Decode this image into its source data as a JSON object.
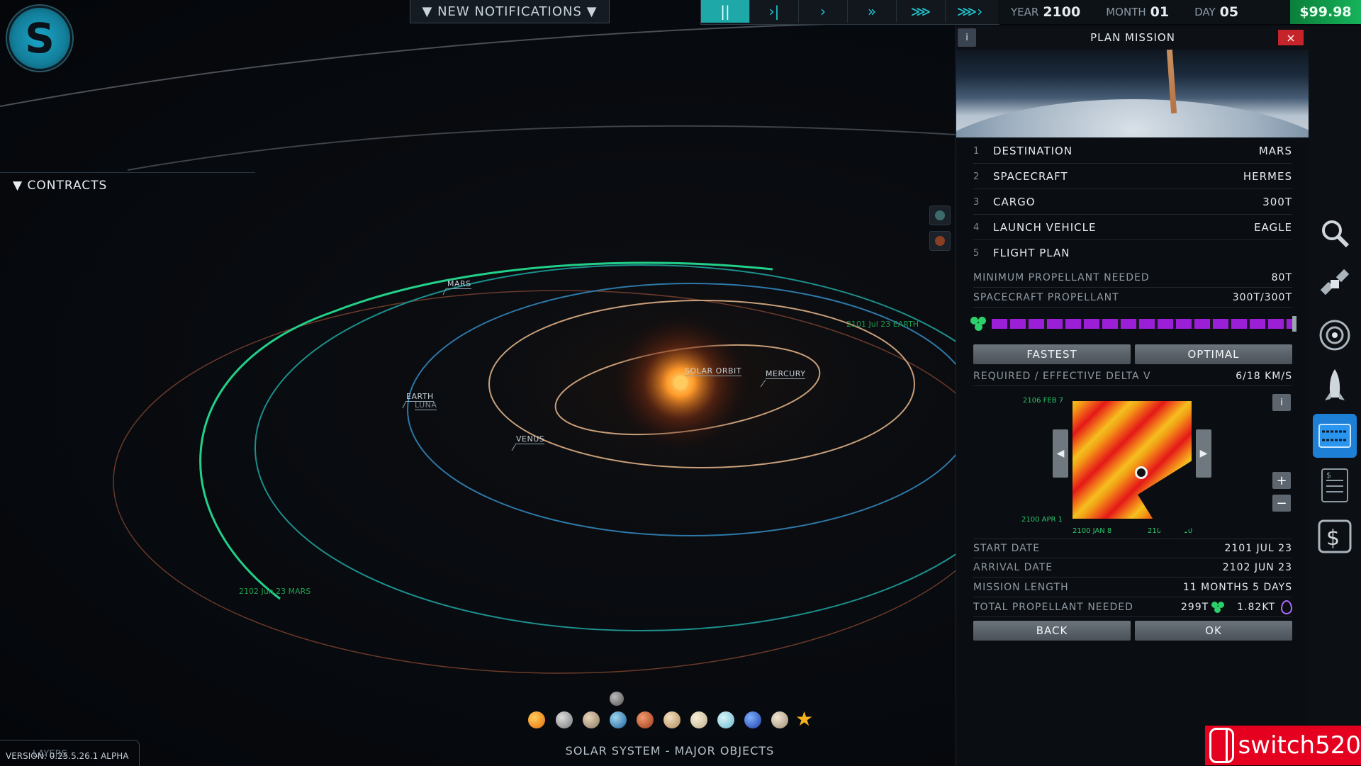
{
  "header": {
    "notifications_label": "▼ NEW NOTIFICATIONS ▼",
    "speed_controls": [
      "||",
      "›|",
      "›",
      "»",
      "⋙",
      "⋙›"
    ],
    "year_label": "YEAR",
    "year_value": "2100",
    "month_label": "MONTH",
    "month_value": "01",
    "day_label": "DAY",
    "day_value": "05",
    "money": "$99.98"
  },
  "logo_letter": "S",
  "contracts_label": "▼ CONTRACTS",
  "map": {
    "labels": {
      "mars": "MARS",
      "earth": "EARTH",
      "luna": "LUNA",
      "venus": "VENUS",
      "solar_orbit": "SOLAR ORBIT",
      "mercury": "MERCURY"
    },
    "date_labels": {
      "earth_arrival": "2101 Jul 23 EARTH",
      "mars_arrival": "2102 Jun 23 MARS"
    }
  },
  "footer": {
    "title": "SOLAR SYSTEM - MAJOR OBJECTS",
    "version": "VERSION: 0.25.5.26.1 ALPHA",
    "layers_label": "LAYERS"
  },
  "panel": {
    "title": "PLAN MISSION",
    "info": "i",
    "close": "×",
    "steps": [
      {
        "num": "1",
        "label": "DESTINATION",
        "value": "MARS"
      },
      {
        "num": "2",
        "label": "SPACECRAFT",
        "value": "HERMES"
      },
      {
        "num": "3",
        "label": "CARGO",
        "value": "300T"
      },
      {
        "num": "4",
        "label": "LAUNCH VEHICLE",
        "value": "EAGLE"
      },
      {
        "num": "5",
        "label": "FLIGHT PLAN",
        "value": ""
      }
    ],
    "min_propellant_label": "MINIMUM PROPELLANT NEEDED",
    "min_propellant_value": "80T",
    "spacecraft_propellant_label": "SPACECRAFT PROPELLANT",
    "spacecraft_propellant_value": "300T/300T",
    "propellant_fill": 1.0,
    "fastest_label": "FASTEST",
    "optimal_label": "OPTIMAL",
    "delta_v_label": "REQUIRED / EFFECTIVE DELTA V",
    "delta_v_value": "6/18 KM/S",
    "porkchop": {
      "y_top": "2106 FEB 7",
      "y_bottom": "2100 APR 1",
      "x_left": "2100 JAN 8",
      "x_right": "2102 SEP 10",
      "info": "i",
      "zoom_in": "+",
      "zoom_out": "−"
    },
    "start_date_label": "START DATE",
    "start_date_value": "2101 JUL 23",
    "arrival_date_label": "ARRIVAL DATE",
    "arrival_date_value": "2102 JUN 23",
    "mission_length_label": "MISSION LENGTH",
    "mission_length_value": "11 MONTHS 5 DAYS",
    "total_propellant_label": "TOTAL PROPELLANT NEEDED",
    "total_propellant_value": "299T",
    "total_water_value": "1.82KT",
    "back_label": "BACK",
    "ok_label": "OK"
  },
  "watermark": "switch520",
  "colors": {
    "accent": "#1fa8a8",
    "money": "#16b35a",
    "propellant": "#9b1fd6",
    "close": "#c4242a"
  }
}
